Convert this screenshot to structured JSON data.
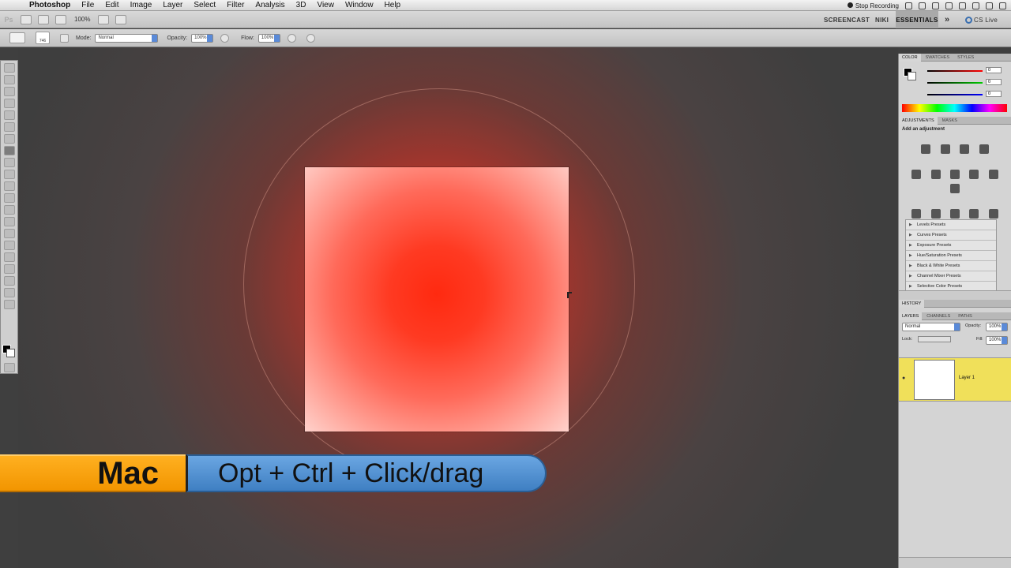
{
  "menubar": {
    "apple": "",
    "items": [
      "Photoshop",
      "File",
      "Edit",
      "Image",
      "Layer",
      "Select",
      "Filter",
      "Analysis",
      "3D",
      "View",
      "Window",
      "Help"
    ],
    "status": "Stop Recording"
  },
  "appbar": {
    "logo": "Ps",
    "zoom": "100%",
    "workspaces": [
      "SCREENCAST",
      "NIKI",
      "ESSENTIALS"
    ],
    "more": "»",
    "cslive": "CS Live"
  },
  "options": {
    "brush_size": "746",
    "mode_label": "Mode:",
    "mode_value": "Normal",
    "opacity_label": "Opacity:",
    "opacity_value": "100%",
    "flow_label": "Flow:",
    "flow_value": "100%"
  },
  "color_panel": {
    "tabs": [
      "COLOR",
      "SWATCHES",
      "STYLES"
    ],
    "r_value": "0",
    "g_value": "0",
    "b_value": "0",
    "colors": {
      "r": "#e02020",
      "g": "#20a020",
      "b": "#2040d0"
    }
  },
  "adjustments_panel": {
    "tabs": [
      "ADJUSTMENTS",
      "MASKS"
    ],
    "title": "Add an adjustment",
    "presets": [
      "Levels Presets",
      "Curves Presets",
      "Exposure Presets",
      "Hue/Saturation Presets",
      "Black & White Presets",
      "Channel Mixer Presets",
      "Selective Color Presets"
    ]
  },
  "history_panel": {
    "tab": "HISTORY"
  },
  "layers_panel": {
    "tabs": [
      "LAYERS",
      "CHANNELS",
      "PATHS"
    ],
    "blend": "Normal",
    "opacity_label": "Opacity:",
    "opacity_value": "100%",
    "lock_label": "Lock:",
    "fill_label": "Fill:",
    "fill_value": "100%",
    "layer_name": "Layer 1"
  },
  "banner": {
    "os": "Mac",
    "shortcut": "Opt + Ctrl + Click/drag"
  },
  "theme": {
    "accent_orange": "#f29500",
    "accent_blue": "#4a8ad0",
    "layer_highlight": "#f0e05a",
    "glow_red": "#ff2a10"
  }
}
